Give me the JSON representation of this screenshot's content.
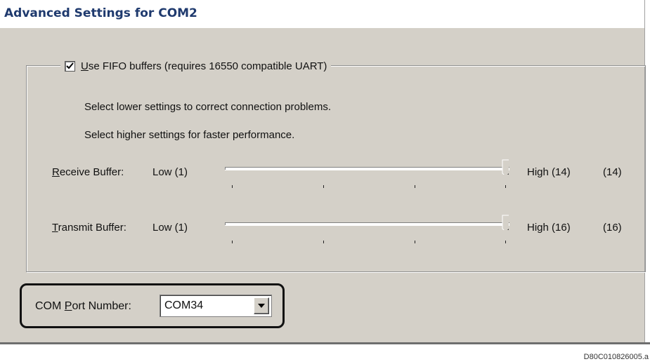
{
  "window": {
    "title": "Advanced Settings for COM2"
  },
  "fifo": {
    "checked": true,
    "label_prefix": "U",
    "label_rest": "se FIFO buffers (requires 16550 compatible UART)"
  },
  "info": {
    "line1": "Select lower settings to correct connection problems.",
    "line2": "Select higher settings for faster performance."
  },
  "receive": {
    "label_prefix": "R",
    "label_rest": "eceive Buffer:",
    "low": "Low (1)",
    "high": "High (14)",
    "value_text": "(14)",
    "value": 14,
    "min": 1,
    "max": 14
  },
  "transmit": {
    "label_prefix": "T",
    "label_rest": "ransmit Buffer:",
    "low": "Low (1)",
    "high": "High (16)",
    "value_text": "(16)",
    "value": 16,
    "min": 1,
    "max": 16
  },
  "com_port": {
    "label_before": "COM ",
    "label_underlined": "P",
    "label_after": "ort Number:",
    "selected": "COM34"
  },
  "figure_code": "D80C010826005.a",
  "colors": {
    "title": "#1f3a6e",
    "dialog_bg": "#d4d0c8"
  }
}
